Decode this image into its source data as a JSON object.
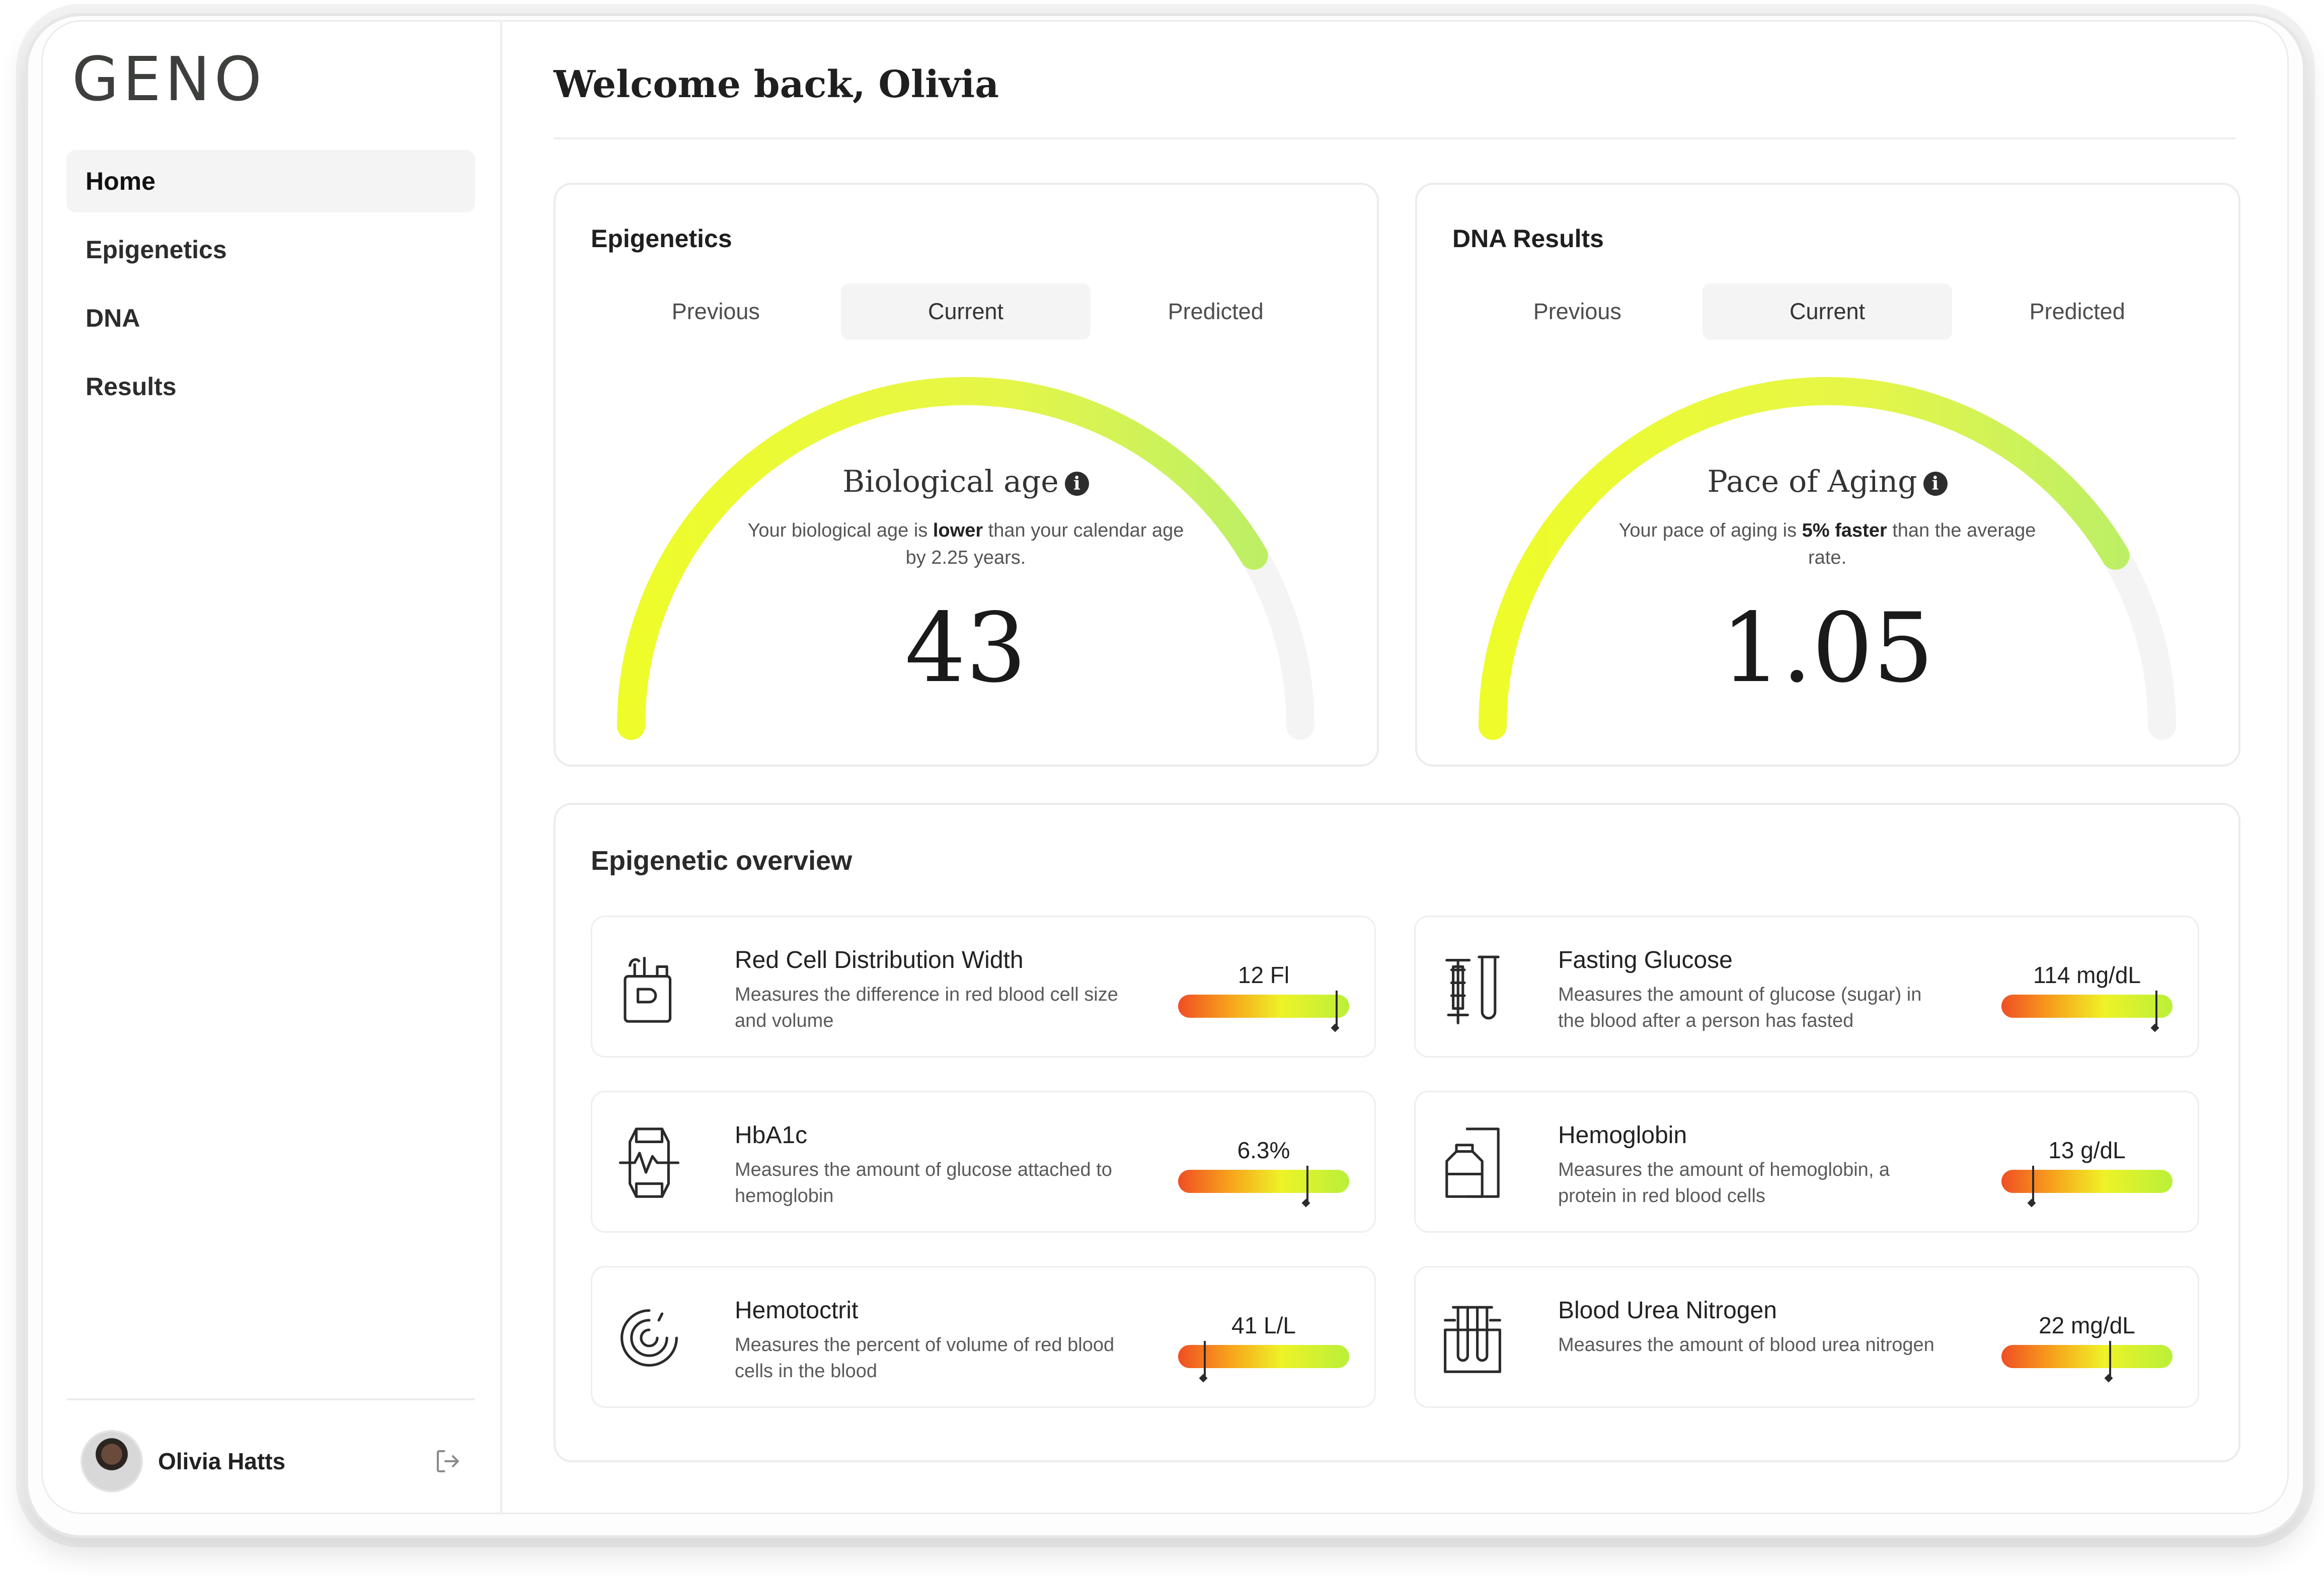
{
  "app": {
    "logo": "GENO"
  },
  "sidebar": {
    "items": [
      {
        "label": "Home",
        "active": true
      },
      {
        "label": "Epigenetics",
        "active": false
      },
      {
        "label": "DNA",
        "active": false
      },
      {
        "label": "Results",
        "active": false
      }
    ],
    "user": {
      "name": "Olivia Hatts"
    }
  },
  "header": {
    "welcome": "Welcome back, Olivia"
  },
  "epigenetics_card": {
    "title": "Epigenetics",
    "tabs": [
      "Previous",
      "Current",
      "Predicted"
    ],
    "active_tab": "Current",
    "gauge": {
      "title": "Biological age",
      "desc_prefix": "Your biological age is ",
      "desc_bold": "lower",
      "desc_suffix": " than your calendar age by 2.25 years.",
      "value": "43",
      "fill_fraction": 0.83
    }
  },
  "dna_card": {
    "title": "DNA Results",
    "tabs": [
      "Previous",
      "Current",
      "Predicted"
    ],
    "active_tab": "Current",
    "gauge": {
      "title": "Pace of Aging",
      "desc_prefix": "Your pace of aging is ",
      "desc_bold": "5% faster",
      "desc_suffix": " than the average rate.",
      "value": "1.05",
      "fill_fraction": 0.83
    }
  },
  "overview": {
    "title": "Epigenetic overview",
    "metrics": [
      {
        "name": "Red Cell Distribution Width",
        "desc": "Measures the difference in red blood cell size and volume",
        "value": "12 Fl",
        "icon": "blood-bag-icon",
        "level": 0.92
      },
      {
        "name": "Fasting Glucose",
        "desc": "Measures the amount of glucose (sugar) in the blood after a person has fasted",
        "value": "114 mg/dL",
        "icon": "syringe-tube-icon",
        "level": 0.9
      },
      {
        "name": "HbA1c",
        "desc": "Measures the amount of glucose attached to hemoglobin",
        "value": "6.3%",
        "icon": "glucose-meter-icon",
        "level": 0.75
      },
      {
        "name": "Hemoglobin",
        "desc": "Measures the amount of hemoglobin, a protein in red blood cells",
        "value": "13 g/dL",
        "icon": "medicine-bottle-icon",
        "level": 0.18
      },
      {
        "name": "Hemotoctrit",
        "desc": "Measures the percent of volume of red blood cells in the blood",
        "value": "41 L/L",
        "icon": "spiral-icon",
        "level": 0.15
      },
      {
        "name": "Blood Urea Nitrogen",
        "desc": "Measures the amount of blood urea nitrogen",
        "value": "22 mg/dL",
        "icon": "test-tubes-icon",
        "level": 0.63
      }
    ]
  },
  "colors": {
    "bar_low": "#f04e23",
    "bar_mid": "#eef227",
    "bar_high": "#b9f03a",
    "gauge_track": "#f4f4f4"
  }
}
